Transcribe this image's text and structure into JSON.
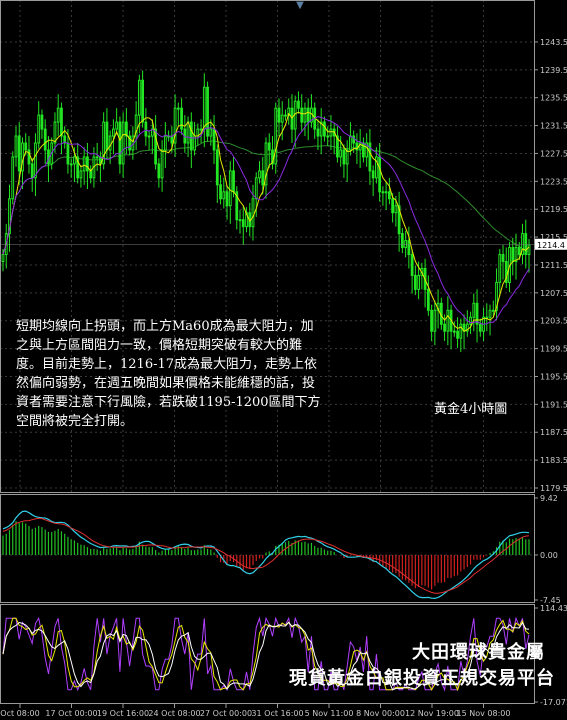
{
  "chart_data": [
    {
      "type": "candlestick",
      "timeframe": "黃金4小時圖",
      "ylim": [
        1179.5,
        1245.5
      ],
      "y_ticks": [
        "1243.5",
        "1239.5",
        "1235.5",
        "1231.5",
        "1227.5",
        "1223.5",
        "1219.5",
        "1215.5",
        "1211.5",
        "1207.5",
        "1203.5",
        "1199.5",
        "1195.5",
        "1191.5",
        "1187.5",
        "1183.5",
        "1179.5"
      ],
      "current_price": "1214.4",
      "x_ticks": [
        "Oct 08:00",
        "17 Oct 00:00",
        "19 Oct 16:00",
        "24 Oct 08:00",
        "27 Oct 00:00",
        "31 Oct 16:00",
        "5 Nov 11:00",
        "8 Nov 00:00",
        "12 Nov 19:00",
        "15 Nov 08:00"
      ],
      "close": [
        1213,
        1216,
        1221,
        1227,
        1230,
        1225,
        1229,
        1228,
        1226,
        1224,
        1229,
        1233,
        1231,
        1228,
        1226,
        1229,
        1232,
        1234,
        1230,
        1229,
        1226,
        1226,
        1227,
        1224,
        1225,
        1227,
        1225,
        1224,
        1227,
        1227,
        1226,
        1232,
        1228,
        1230,
        1231,
        1232,
        1226,
        1232,
        1230,
        1228,
        1230,
        1233,
        1238,
        1232,
        1230,
        1230,
        1231,
        1226,
        1224,
        1228,
        1230,
        1230,
        1229,
        1234,
        1234,
        1231,
        1229,
        1232,
        1228,
        1230,
        1231,
        1231,
        1237,
        1230,
        1231,
        1228,
        1223,
        1221,
        1222,
        1220,
        1225,
        1222,
        1218,
        1218,
        1217,
        1219,
        1217,
        1221,
        1224,
        1225,
        1223,
        1229,
        1228,
        1226,
        1234,
        1232,
        1233,
        1233,
        1234,
        1231,
        1235,
        1234,
        1232,
        1234,
        1232,
        1234,
        1231,
        1230,
        1232,
        1230,
        1230,
        1231,
        1230,
        1227,
        1228,
        1226,
        1228,
        1230,
        1229,
        1228,
        1229,
        1227,
        1229,
        1225,
        1224,
        1227,
        1222,
        1222,
        1222,
        1221,
        1219,
        1220,
        1216,
        1214,
        1215,
        1213,
        1210,
        1208,
        1210,
        1211,
        1208,
        1205,
        1202,
        1205,
        1206,
        1203,
        1202,
        1205,
        1202,
        1202,
        1201,
        1203,
        1202,
        1203,
        1204,
        1206,
        1203,
        1202,
        1204,
        1204,
        1205,
        1205,
        1209,
        1213,
        1212,
        1209,
        1214,
        1212,
        1214,
        1213,
        1216,
        1213,
        1214.4
      ],
      "series": [
        {
          "name": "MA60",
          "color": "#2e8b2e"
        },
        {
          "name": "",
          "color": "#e8e800"
        },
        {
          "name": "",
          "color": "#8a2be2"
        }
      ],
      "annotation": [
        "短期均線向上拐頭，而上方Ma60成為最大阻力，加",
        "之與上方區間阻力一致，價格短期突破有較大的難",
        "度。目前走勢上，1216-17成為最大阻力，走勢上依",
        "然偏向弱勢，在週五晚間如果價格未能維穩的話，投",
        "資者需要注意下行風險，若跌破1195-1200區間下方",
        "空間將被完全打開。"
      ]
    },
    {
      "type": "bar+line",
      "name": "MACD",
      "ylim": [
        -7.45,
        9.42
      ],
      "y_ticks": [
        "9.42",
        "0.00",
        "-7.45"
      ],
      "hist": [
        3.2,
        3.5,
        4.1,
        5.0,
        5.6,
        5.3,
        5.4,
        5.2,
        4.8,
        4.3,
        4.5,
        4.8,
        4.6,
        4.2,
        3.8,
        3.8,
        4.0,
        4.3,
        3.9,
        3.5,
        3.0,
        2.6,
        2.4,
        2.0,
        1.7,
        1.6,
        1.3,
        1.0,
        1.0,
        0.9,
        0.7,
        1.2,
        1.0,
        1.1,
        1.2,
        1.3,
        0.8,
        1.2,
        1.1,
        0.9,
        1.0,
        1.4,
        2.2,
        1.7,
        1.4,
        1.3,
        1.3,
        0.8,
        0.4,
        0.7,
        0.9,
        0.9,
        0.8,
        1.4,
        1.6,
        1.3,
        1.0,
        1.2,
        0.8,
        0.8,
        0.9,
        0.9,
        1.6,
        1.0,
        0.9,
        0.4,
        -0.5,
        -1.2,
        -1.3,
        -1.7,
        -1.0,
        -1.2,
        -1.9,
        -2.2,
        -2.5,
        -2.2,
        -2.3,
        -1.7,
        -1.0,
        -0.6,
        -0.6,
        0.4,
        0.6,
        0.4,
        1.5,
        1.7,
        2.0,
        2.1,
        2.3,
        2.0,
        2.4,
        2.4,
        2.1,
        2.2,
        1.9,
        2.0,
        1.5,
        1.2,
        1.2,
        0.9,
        0.7,
        0.7,
        0.5,
        0.0,
        -0.1,
        -0.5,
        -0.4,
        -0.1,
        -0.1,
        -0.3,
        -0.2,
        -0.5,
        -0.3,
        -0.9,
        -1.2,
        -0.9,
        -1.6,
        -2.0,
        -2.2,
        -2.5,
        -2.9,
        -3.0,
        -3.6,
        -4.1,
        -4.2,
        -4.6,
        -5.1,
        -5.5,
        -5.3,
        -5.0,
        -5.1,
        -5.4,
        -5.7,
        -5.1,
        -4.6,
        -4.6,
        -4.5,
        -3.8,
        -3.8,
        -3.5,
        -3.4,
        -2.7,
        -2.4,
        -2.0,
        -1.6,
        -0.8,
        -0.8,
        -0.8,
        -0.4,
        -0.1,
        0.3,
        0.6,
        1.3,
        2.2,
        2.4,
        2.1,
        2.7,
        2.6,
        2.8,
        2.7,
        3.0,
        2.6,
        2.6
      ]
    },
    {
      "type": "line",
      "name": "Stochastic",
      "y_ticks": [
        "114.4376",
        "-17.0714"
      ]
    }
  ],
  "brand": {
    "line1": "大田環球貴金屬",
    "line2": "現貨黃金白銀投資正規交易平台"
  },
  "top_marker": "▼"
}
